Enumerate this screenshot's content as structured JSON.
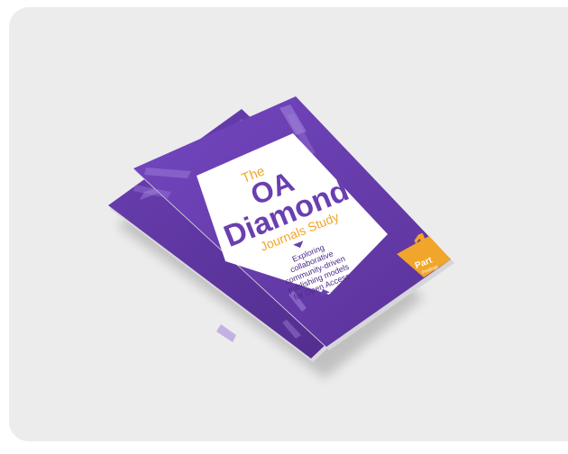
{
  "cover": {
    "the": "The",
    "oa": "OA",
    "diamond": "Diamond",
    "journals_study": "Journals Study",
    "subtitle_lines": [
      "Exploring",
      "collaborative",
      "community-driven",
      "publishing models",
      "for Open Access"
    ],
    "part_number": "1",
    "part_label": "Part",
    "part_sub": "Findings"
  },
  "colors": {
    "purple": "#6a3fb0",
    "purple_dark": "#4d2a87",
    "orange": "#f1a52a",
    "panel": "#ffffff",
    "background": "#ececed"
  }
}
